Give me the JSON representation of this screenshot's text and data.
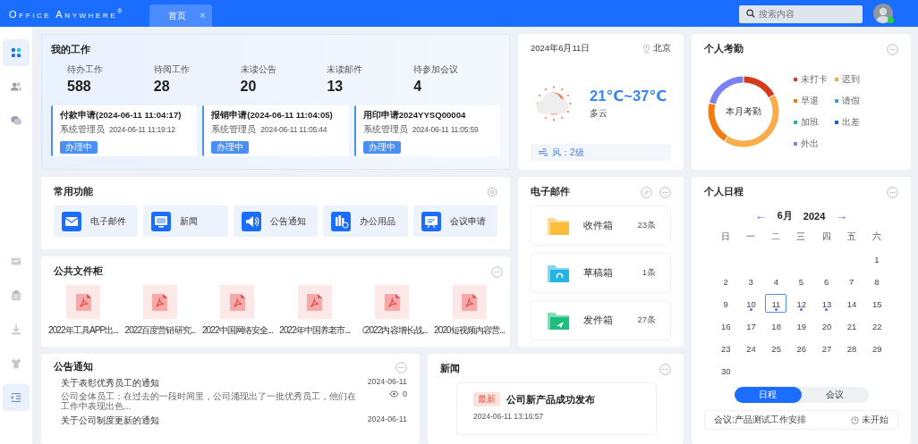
{
  "topbar": {
    "logo": "Office Anywhere",
    "logo_mark": "®",
    "tabs": [
      {
        "label": "首页",
        "close": "×",
        "selected": true
      }
    ],
    "search": {
      "placeholder": "搜索内容"
    },
    "user": {
      "online": true
    }
  },
  "sidebar": {
    "items": [
      {
        "selected": true
      },
      {
        "selected": false
      },
      {
        "selected": false
      },
      {
        "selected": false
      },
      {
        "selected": false
      },
      {
        "selected": false
      },
      {
        "selected": false
      },
      {
        "selected": true
      }
    ]
  },
  "my_work": {
    "title": "我的工作",
    "stats": [
      {
        "label": "待办工作",
        "value": "588"
      },
      {
        "label": "待阅工作",
        "value": "28"
      },
      {
        "label": "未读公告",
        "value": "20"
      },
      {
        "label": "未读邮件",
        "value": "13"
      },
      {
        "label": "待参加会议",
        "value": "4"
      }
    ],
    "items": [
      {
        "title": "付款申请(2024-06-11 11:04:17)",
        "user": "系统管理员",
        "time": "2024-06-11 11:19:12",
        "status": "办理中"
      },
      {
        "title": "报销申请(2024-06-11 11:04:05)",
        "user": "系统管理员",
        "time": "2024-06-11 11:05:44",
        "status": "办理中"
      },
      {
        "title": "用印申请2024YYSQ00004",
        "user": "系统管理员",
        "time": "2024-06-11 11:05:59",
        "status": "办理中"
      }
    ]
  },
  "weather": {
    "date": "2024年6月11日",
    "city": "北京",
    "temperature": "21℃~37℃",
    "condition": "多云",
    "wind": "风：2级"
  },
  "attendance": {
    "title": "个人考勤",
    "center_label": "本月考勤",
    "legend": [
      {
        "label": "未打卡",
        "color": "#d63a1c"
      },
      {
        "label": "迟到",
        "color": "#f6a93b"
      },
      {
        "label": "早退",
        "color": "#f27b14"
      },
      {
        "label": "请假",
        "color": "#3b9cf0"
      },
      {
        "label": "加班",
        "color": "#1fbf8a"
      },
      {
        "label": "出差",
        "color": "#1e5fd6"
      },
      {
        "label": "外出",
        "color": "#7b80f2"
      }
    ]
  },
  "functions": {
    "title": "常用功能",
    "items": [
      {
        "label": "电子邮件"
      },
      {
        "label": "新闻"
      },
      {
        "label": "公告通知"
      },
      {
        "label": "办公用品"
      },
      {
        "label": "会议申请"
      }
    ]
  },
  "files": {
    "title": "公共文件柜",
    "items": [
      {
        "name": "2022年工具APP出..."
      },
      {
        "name": "2022百度营销研究..."
      },
      {
        "name": "2022中国网络安全..."
      },
      {
        "name": "2022年中国养老市..."
      },
      {
        "name": "《2022内容增长战..."
      },
      {
        "name": "2020短视频内容营..."
      }
    ]
  },
  "email": {
    "title": "电子邮件",
    "folders": [
      {
        "name": "收件箱",
        "count": "23条",
        "color": "#fbbd3a"
      },
      {
        "name": "草稿箱",
        "count": "1条",
        "color": "#22b5e6"
      },
      {
        "name": "发件箱",
        "count": "27条",
        "color": "#1cc07c"
      }
    ]
  },
  "schedule": {
    "title": "个人日程",
    "month": "6月",
    "year": "2024",
    "prev": "←",
    "next": "→",
    "weekdays": [
      "日",
      "一",
      "二",
      "三",
      "四",
      "五",
      "六"
    ],
    "weeks": [
      [
        {
          "day": "1",
          "selected": false,
          "has_event": false
        }
      ],
      [
        {
          "day": "2",
          "selected": false,
          "has_event": false
        },
        {
          "day": "3",
          "selected": false,
          "has_event": false
        },
        {
          "day": "4",
          "selected": false,
          "has_event": false
        },
        {
          "day": "5",
          "selected": false,
          "has_event": false
        },
        {
          "day": "6",
          "selected": false,
          "has_event": false
        },
        {
          "day": "7",
          "selected": false,
          "has_event": false
        },
        {
          "day": "8",
          "selected": false,
          "has_event": false
        }
      ],
      [
        {
          "day": "9",
          "selected": false,
          "has_event": false
        },
        {
          "day": "10",
          "selected": false,
          "has_event": true
        },
        {
          "day": "11",
          "selected": true,
          "has_event": true
        },
        {
          "day": "12",
          "selected": false,
          "has_event": true
        },
        {
          "day": "13",
          "selected": false,
          "has_event": true
        },
        {
          "day": "14",
          "selected": false,
          "has_event": false
        },
        {
          "day": "15",
          "selected": false,
          "has_event": false
        }
      ],
      [
        {
          "day": "16",
          "selected": false,
          "has_event": false
        },
        {
          "day": "17",
          "selected": false,
          "has_event": false
        },
        {
          "day": "18",
          "selected": false,
          "has_event": false
        },
        {
          "day": "19",
          "selected": false,
          "has_event": false
        },
        {
          "day": "20",
          "selected": false,
          "has_event": false
        },
        {
          "day": "21",
          "selected": false,
          "has_event": false
        },
        {
          "day": "22",
          "selected": false,
          "has_event": false
        }
      ],
      [
        {
          "day": "23",
          "selected": false,
          "has_event": false
        },
        {
          "day": "24",
          "selected": false,
          "has_event": false
        },
        {
          "day": "25",
          "selected": false,
          "has_event": false
        },
        {
          "day": "26",
          "selected": false,
          "has_event": false
        },
        {
          "day": "27",
          "selected": false,
          "has_event": false
        },
        {
          "day": "28",
          "selected": false,
          "has_event": false
        },
        {
          "day": "29",
          "selected": false,
          "has_event": false
        }
      ],
      [
        {
          "day": "30",
          "selected": false,
          "has_event": false
        }
      ]
    ],
    "tabs": [
      {
        "label": "日程",
        "selected": true
      },
      {
        "label": "会议",
        "selected": false
      }
    ],
    "items": [
      {
        "title": "会议:产品测试工作安排",
        "status": "未开始"
      }
    ]
  },
  "notices": {
    "title": "公告通知",
    "items": [
      {
        "title": "关于表彰优秀员工的通知",
        "summary": "公司全体员工：在过去的一段时间里，公司涌现出了一批优秀员工，他们在工作中表现出色...",
        "date": "2024-06-11",
        "views": "0"
      },
      {
        "title": "关于公司制度更新的通知",
        "date": "2024-06-11"
      }
    ]
  },
  "news": {
    "title": "新闻",
    "items": [
      {
        "badge": "最新",
        "title": "公司新产品成功发布",
        "time": "2024-06-11 13:16:57"
      }
    ]
  }
}
